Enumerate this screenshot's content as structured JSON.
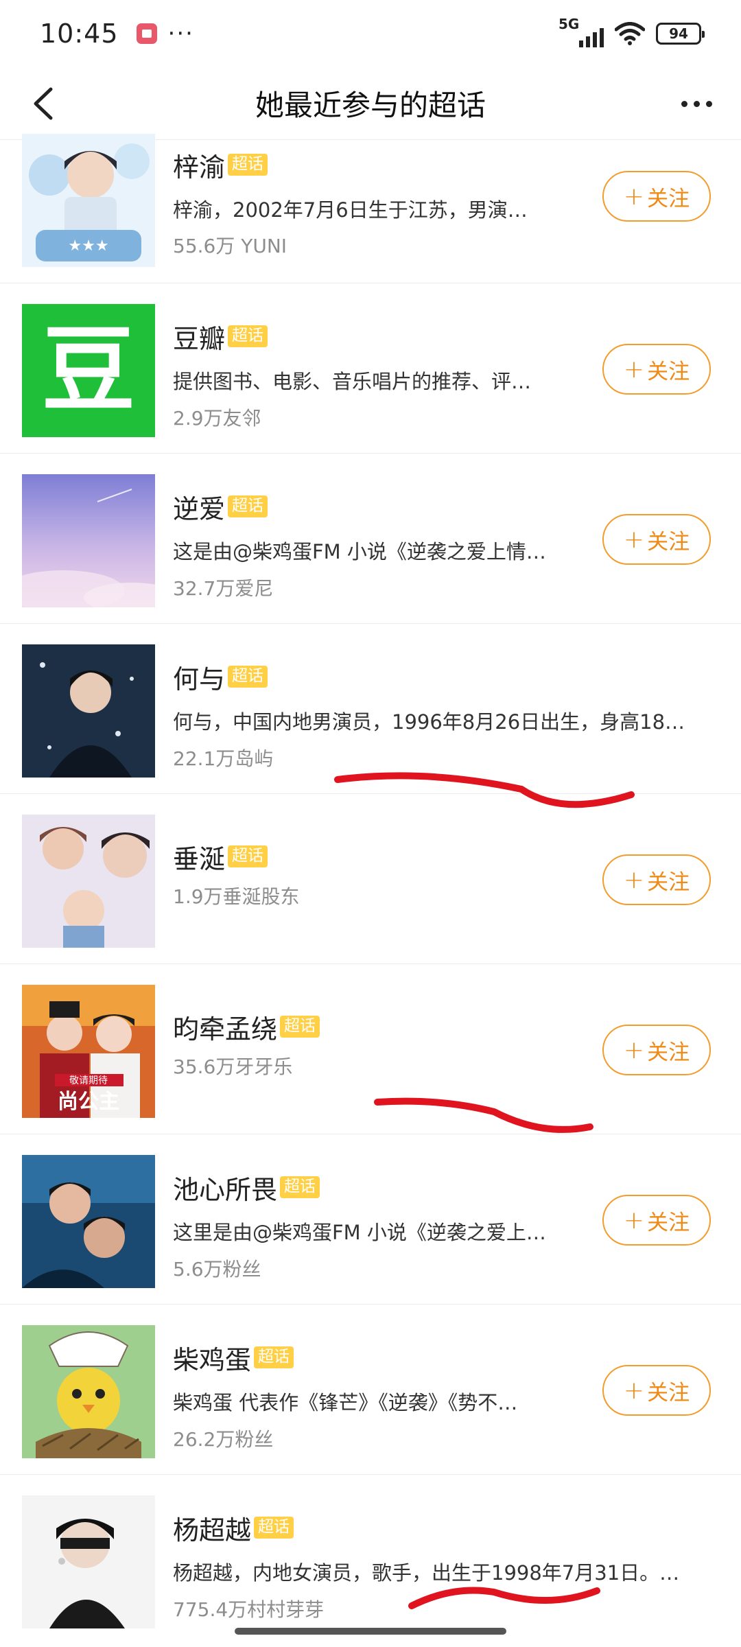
{
  "status": {
    "time": "10:45",
    "network": "5G",
    "battery": "94"
  },
  "nav": {
    "title": "她最近参与的超话"
  },
  "tag_label": "超话",
  "follow_label": "关注",
  "items": [
    {
      "name": "梓渝",
      "desc": "梓渝，2002年7月6日生于江苏，男演…",
      "stats": "55.6万 YUNI",
      "follow": true
    },
    {
      "name": "豆瓣",
      "desc": "提供图书、电影、音乐唱片的推荐、评…",
      "stats": "2.9万友邻",
      "follow": true
    },
    {
      "name": "逆爱",
      "desc": "这是由@柴鸡蛋FM 小说《逆袭之爱上情…",
      "stats": "32.7万爱尼",
      "follow": true
    },
    {
      "name": "何与",
      "desc": "何与，中国内地男演员，1996年8月26日出生，身高18…",
      "stats": "22.1万岛屿",
      "follow": false
    },
    {
      "name": "垂涎",
      "desc": "",
      "stats": "1.9万垂涎股东",
      "follow": true
    },
    {
      "name": "昀牵孟绕",
      "desc": "",
      "stats": "35.6万牙牙乐",
      "follow": true
    },
    {
      "name": "池心所畏",
      "desc": "这里是由@柴鸡蛋FM 小说《逆袭之爱上…",
      "stats": "5.6万粉丝",
      "follow": true
    },
    {
      "name": "柴鸡蛋",
      "desc": "柴鸡蛋  代表作《锋芒》《逆袭》《势不…",
      "stats": "26.2万粉丝",
      "follow": true
    },
    {
      "name": "杨超越",
      "desc": "杨超越，内地女演员，歌手，出生于1998年7月31日。…",
      "stats": "775.4万村村芽芽",
      "follow": false
    }
  ],
  "thumb_text": {
    "douban_glyph": "豆",
    "poster_badge": "敬请期待",
    "poster_title": "尚公主"
  },
  "colors": {
    "accent": "#f08a16",
    "tag_bg": "#ffcf45",
    "douban_green": "#1fbf3a",
    "scribble_red": "#e0141e"
  }
}
